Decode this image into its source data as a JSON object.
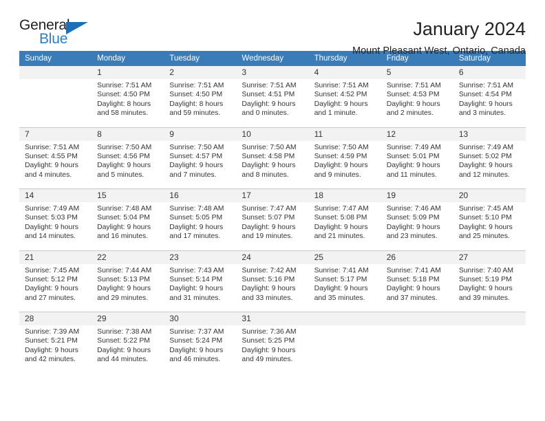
{
  "brand": {
    "name_top": "General",
    "name_bottom": "Blue",
    "accent_color": "#1b6fb5",
    "text_color": "#231f20"
  },
  "header": {
    "title": "January 2024",
    "subtitle": "Mount Pleasant West, Ontario, Canada"
  },
  "calendar": {
    "header_bg": "#3a7cb8",
    "daynum_bg": "#f2f2f2",
    "weekday_headers": [
      "Sunday",
      "Monday",
      "Tuesday",
      "Wednesday",
      "Thursday",
      "Friday",
      "Saturday"
    ],
    "weeks": [
      {
        "days": [
          {
            "num": "",
            "sunrise": "",
            "sunset": "",
            "daylight_1": "",
            "daylight_2": ""
          },
          {
            "num": "1",
            "sunrise": "Sunrise: 7:51 AM",
            "sunset": "Sunset: 4:50 PM",
            "daylight_1": "Daylight: 8 hours",
            "daylight_2": "and 58 minutes."
          },
          {
            "num": "2",
            "sunrise": "Sunrise: 7:51 AM",
            "sunset": "Sunset: 4:50 PM",
            "daylight_1": "Daylight: 8 hours",
            "daylight_2": "and 59 minutes."
          },
          {
            "num": "3",
            "sunrise": "Sunrise: 7:51 AM",
            "sunset": "Sunset: 4:51 PM",
            "daylight_1": "Daylight: 9 hours",
            "daylight_2": "and 0 minutes."
          },
          {
            "num": "4",
            "sunrise": "Sunrise: 7:51 AM",
            "sunset": "Sunset: 4:52 PM",
            "daylight_1": "Daylight: 9 hours",
            "daylight_2": "and 1 minute."
          },
          {
            "num": "5",
            "sunrise": "Sunrise: 7:51 AM",
            "sunset": "Sunset: 4:53 PM",
            "daylight_1": "Daylight: 9 hours",
            "daylight_2": "and 2 minutes."
          },
          {
            "num": "6",
            "sunrise": "Sunrise: 7:51 AM",
            "sunset": "Sunset: 4:54 PM",
            "daylight_1": "Daylight: 9 hours",
            "daylight_2": "and 3 minutes."
          }
        ]
      },
      {
        "days": [
          {
            "num": "7",
            "sunrise": "Sunrise: 7:51 AM",
            "sunset": "Sunset: 4:55 PM",
            "daylight_1": "Daylight: 9 hours",
            "daylight_2": "and 4 minutes."
          },
          {
            "num": "8",
            "sunrise": "Sunrise: 7:50 AM",
            "sunset": "Sunset: 4:56 PM",
            "daylight_1": "Daylight: 9 hours",
            "daylight_2": "and 5 minutes."
          },
          {
            "num": "9",
            "sunrise": "Sunrise: 7:50 AM",
            "sunset": "Sunset: 4:57 PM",
            "daylight_1": "Daylight: 9 hours",
            "daylight_2": "and 7 minutes."
          },
          {
            "num": "10",
            "sunrise": "Sunrise: 7:50 AM",
            "sunset": "Sunset: 4:58 PM",
            "daylight_1": "Daylight: 9 hours",
            "daylight_2": "and 8 minutes."
          },
          {
            "num": "11",
            "sunrise": "Sunrise: 7:50 AM",
            "sunset": "Sunset: 4:59 PM",
            "daylight_1": "Daylight: 9 hours",
            "daylight_2": "and 9 minutes."
          },
          {
            "num": "12",
            "sunrise": "Sunrise: 7:49 AM",
            "sunset": "Sunset: 5:01 PM",
            "daylight_1": "Daylight: 9 hours",
            "daylight_2": "and 11 minutes."
          },
          {
            "num": "13",
            "sunrise": "Sunrise: 7:49 AM",
            "sunset": "Sunset: 5:02 PM",
            "daylight_1": "Daylight: 9 hours",
            "daylight_2": "and 12 minutes."
          }
        ]
      },
      {
        "days": [
          {
            "num": "14",
            "sunrise": "Sunrise: 7:49 AM",
            "sunset": "Sunset: 5:03 PM",
            "daylight_1": "Daylight: 9 hours",
            "daylight_2": "and 14 minutes."
          },
          {
            "num": "15",
            "sunrise": "Sunrise: 7:48 AM",
            "sunset": "Sunset: 5:04 PM",
            "daylight_1": "Daylight: 9 hours",
            "daylight_2": "and 16 minutes."
          },
          {
            "num": "16",
            "sunrise": "Sunrise: 7:48 AM",
            "sunset": "Sunset: 5:05 PM",
            "daylight_1": "Daylight: 9 hours",
            "daylight_2": "and 17 minutes."
          },
          {
            "num": "17",
            "sunrise": "Sunrise: 7:47 AM",
            "sunset": "Sunset: 5:07 PM",
            "daylight_1": "Daylight: 9 hours",
            "daylight_2": "and 19 minutes."
          },
          {
            "num": "18",
            "sunrise": "Sunrise: 7:47 AM",
            "sunset": "Sunset: 5:08 PM",
            "daylight_1": "Daylight: 9 hours",
            "daylight_2": "and 21 minutes."
          },
          {
            "num": "19",
            "sunrise": "Sunrise: 7:46 AM",
            "sunset": "Sunset: 5:09 PM",
            "daylight_1": "Daylight: 9 hours",
            "daylight_2": "and 23 minutes."
          },
          {
            "num": "20",
            "sunrise": "Sunrise: 7:45 AM",
            "sunset": "Sunset: 5:10 PM",
            "daylight_1": "Daylight: 9 hours",
            "daylight_2": "and 25 minutes."
          }
        ]
      },
      {
        "days": [
          {
            "num": "21",
            "sunrise": "Sunrise: 7:45 AM",
            "sunset": "Sunset: 5:12 PM",
            "daylight_1": "Daylight: 9 hours",
            "daylight_2": "and 27 minutes."
          },
          {
            "num": "22",
            "sunrise": "Sunrise: 7:44 AM",
            "sunset": "Sunset: 5:13 PM",
            "daylight_1": "Daylight: 9 hours",
            "daylight_2": "and 29 minutes."
          },
          {
            "num": "23",
            "sunrise": "Sunrise: 7:43 AM",
            "sunset": "Sunset: 5:14 PM",
            "daylight_1": "Daylight: 9 hours",
            "daylight_2": "and 31 minutes."
          },
          {
            "num": "24",
            "sunrise": "Sunrise: 7:42 AM",
            "sunset": "Sunset: 5:16 PM",
            "daylight_1": "Daylight: 9 hours",
            "daylight_2": "and 33 minutes."
          },
          {
            "num": "25",
            "sunrise": "Sunrise: 7:41 AM",
            "sunset": "Sunset: 5:17 PM",
            "daylight_1": "Daylight: 9 hours",
            "daylight_2": "and 35 minutes."
          },
          {
            "num": "26",
            "sunrise": "Sunrise: 7:41 AM",
            "sunset": "Sunset: 5:18 PM",
            "daylight_1": "Daylight: 9 hours",
            "daylight_2": "and 37 minutes."
          },
          {
            "num": "27",
            "sunrise": "Sunrise: 7:40 AM",
            "sunset": "Sunset: 5:19 PM",
            "daylight_1": "Daylight: 9 hours",
            "daylight_2": "and 39 minutes."
          }
        ]
      },
      {
        "days": [
          {
            "num": "28",
            "sunrise": "Sunrise: 7:39 AM",
            "sunset": "Sunset: 5:21 PM",
            "daylight_1": "Daylight: 9 hours",
            "daylight_2": "and 42 minutes."
          },
          {
            "num": "29",
            "sunrise": "Sunrise: 7:38 AM",
            "sunset": "Sunset: 5:22 PM",
            "daylight_1": "Daylight: 9 hours",
            "daylight_2": "and 44 minutes."
          },
          {
            "num": "30",
            "sunrise": "Sunrise: 7:37 AM",
            "sunset": "Sunset: 5:24 PM",
            "daylight_1": "Daylight: 9 hours",
            "daylight_2": "and 46 minutes."
          },
          {
            "num": "31",
            "sunrise": "Sunrise: 7:36 AM",
            "sunset": "Sunset: 5:25 PM",
            "daylight_1": "Daylight: 9 hours",
            "daylight_2": "and 49 minutes."
          },
          {
            "num": "",
            "sunrise": "",
            "sunset": "",
            "daylight_1": "",
            "daylight_2": ""
          },
          {
            "num": "",
            "sunrise": "",
            "sunset": "",
            "daylight_1": "",
            "daylight_2": ""
          },
          {
            "num": "",
            "sunrise": "",
            "sunset": "",
            "daylight_1": "",
            "daylight_2": ""
          }
        ]
      }
    ]
  }
}
